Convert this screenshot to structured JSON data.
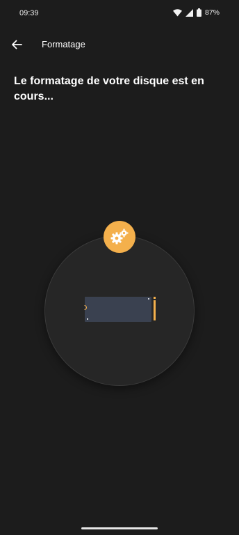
{
  "status_bar": {
    "time": "09:39",
    "battery_percent": "87%",
    "icons": [
      "wifi-icon",
      "cell-signal-icon",
      "battery-icon"
    ]
  },
  "top_bar": {
    "back_icon": "arrow-left-icon",
    "title": "Formatage"
  },
  "main": {
    "heading": "Le formatage de votre disque est en cours..."
  },
  "illustration": {
    "badge_icon": "gears-icon",
    "drive_icon": "drive-icon"
  },
  "colors": {
    "background": "#1c1c1c",
    "accent": "#f4b04c",
    "circle": "#262626",
    "drive": "#3a4150"
  }
}
